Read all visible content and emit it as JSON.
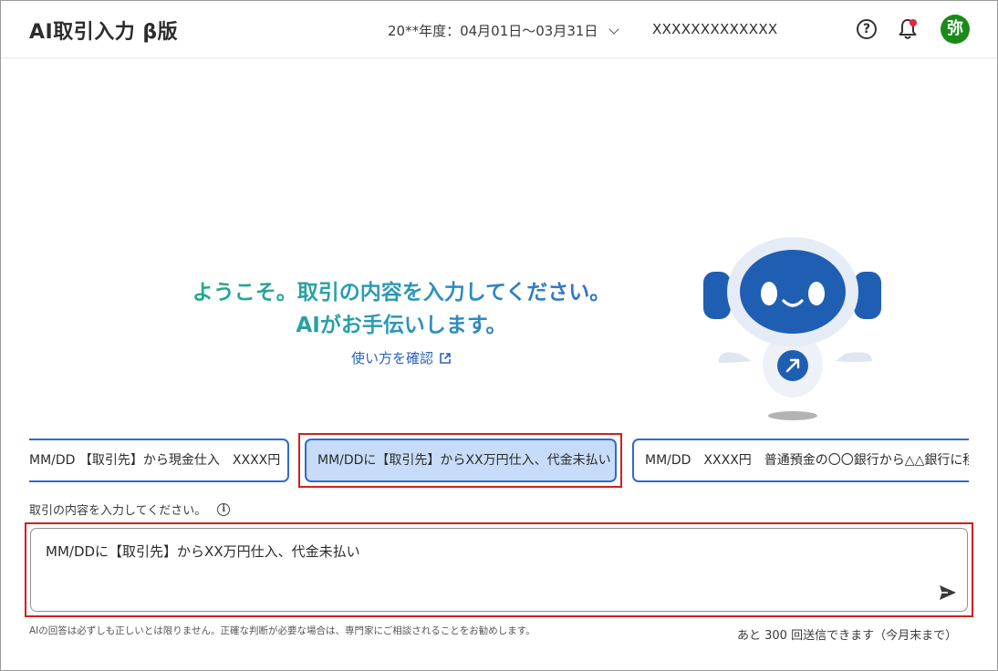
{
  "header": {
    "app_title": "AI取引入力 β版",
    "period": "20**年度：04月01日〜03月31日",
    "company": "XXXXXXXXXXXXX",
    "avatar_initial": "弥"
  },
  "welcome": {
    "line1": "ようこそ。取引の内容を入力してください。",
    "line2": "AIがお手伝いします。",
    "howto_link": "使い方を確認"
  },
  "suggestions": [
    "MM/DD 【取引先】から現金仕入　XXXX円",
    "MM/DDに【取引先】からXX万円仕入、代金未払い",
    "MM/DD　XXXX円　普通預金の〇〇銀行から△△銀行に移"
  ],
  "input": {
    "label": "取引の内容を入力してください。",
    "value": "MM/DDに【取引先】からXX万円仕入、代金未払い"
  },
  "footer": {
    "disclaimer": "AIの回答は必ずしも正しいとは限りません。正確な判断が必要な場合は、専門家にご相談されることをお勧めします。",
    "remaining": "あと 300 回送信できます（今月末まで）"
  },
  "colors": {
    "accent_blue": "#2f6bd0",
    "selected_chip_bg": "#c7dcf8",
    "highlight_red": "#d21f1f",
    "avatar_green": "#1a8a1a",
    "welcome_gradient_start": "#1fae7e",
    "welcome_gradient_end": "#3568d4",
    "robot_blue": "#1f5fb3"
  },
  "icons": {
    "period_dropdown": "chevron-down-icon",
    "help": "question-circle-icon",
    "notifications": "bell-icon",
    "external_link": "external-link-icon",
    "info": "info-icon",
    "send": "send-icon"
  }
}
